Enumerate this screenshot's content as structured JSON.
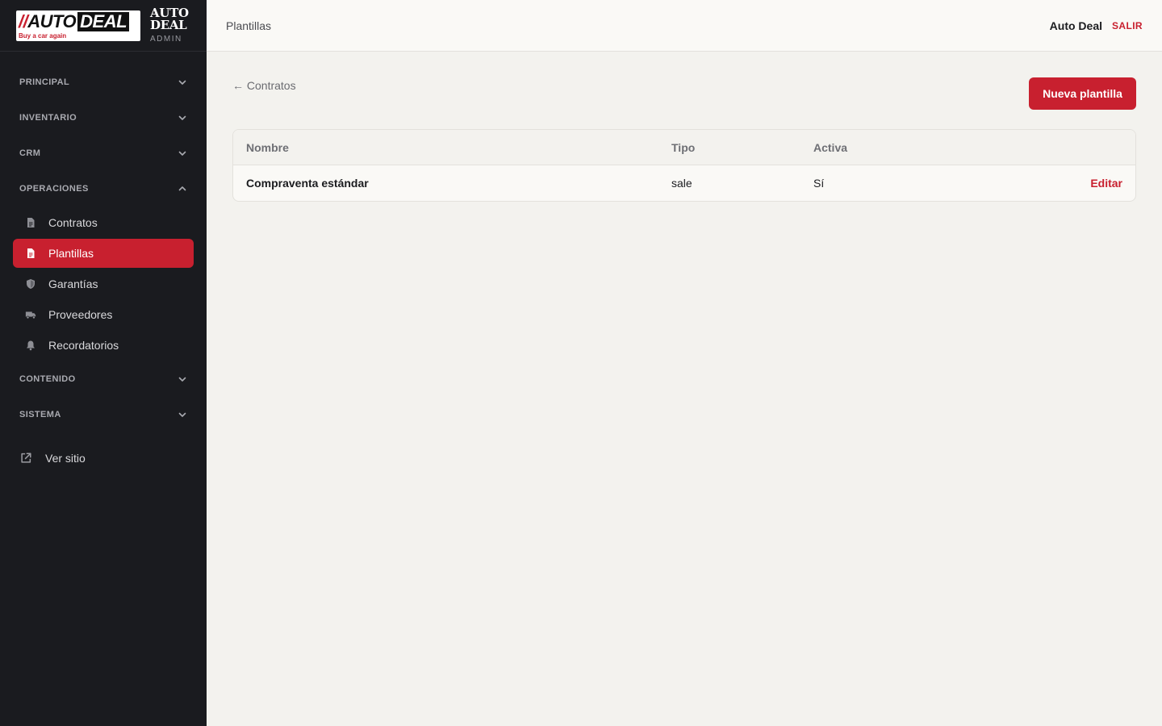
{
  "brand": {
    "logo_slashes": "//",
    "logo_auto": "AUTO",
    "logo_deal": "DEAL",
    "logo_tagline": "Buy a car again",
    "name": "AUTO\nDEAL",
    "subtitle": "ADMIN",
    "accent_color": "#c8202f"
  },
  "sidebar": {
    "groups": [
      {
        "label": "PRINCIPAL",
        "expanded": false
      },
      {
        "label": "INVENTARIO",
        "expanded": false
      },
      {
        "label": "CRM",
        "expanded": false
      },
      {
        "label": "OPERACIONES",
        "expanded": true
      },
      {
        "label": "CONTENIDO",
        "expanded": false
      },
      {
        "label": "SISTEMA",
        "expanded": false
      }
    ],
    "operaciones_items": [
      {
        "label": "Contratos",
        "icon": "document-icon",
        "active": false
      },
      {
        "label": "Plantillas",
        "icon": "file-icon",
        "active": true
      },
      {
        "label": "Garantías",
        "icon": "shield-icon",
        "active": false
      },
      {
        "label": "Proveedores",
        "icon": "truck-icon",
        "active": false
      },
      {
        "label": "Recordatorios",
        "icon": "bell-icon",
        "active": false
      }
    ],
    "ver_sitio": {
      "label": "Ver sitio",
      "icon": "external-link-icon"
    }
  },
  "header": {
    "title": "Plantillas",
    "user": "Auto Deal",
    "logout": "SALIR"
  },
  "main": {
    "back_link": "← Contratos",
    "new_button": "Nueva plantilla",
    "table": {
      "columns": [
        "Nombre",
        "Tipo",
        "Activa"
      ],
      "rows": [
        {
          "nombre": "Compraventa estándar",
          "tipo": "sale",
          "activa": "Sí",
          "action": "Editar"
        }
      ]
    }
  }
}
